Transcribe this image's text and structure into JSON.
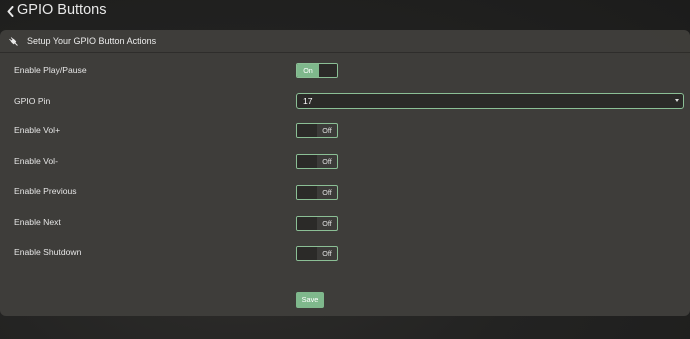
{
  "header": {
    "title": "GPIO Buttons",
    "back_icon": "chevron-left-icon"
  },
  "panel": {
    "title": "Setup Your GPIO Button Actions",
    "icon": "plug-icon"
  },
  "settings": {
    "play_pause": {
      "label": "Enable Play/Pause",
      "state": "On"
    },
    "gpio_pin": {
      "label": "GPIO Pin",
      "value": "17"
    },
    "vol_up": {
      "label": "Enable Vol+",
      "state": "Off"
    },
    "vol_down": {
      "label": "Enable Vol-",
      "state": "Off"
    },
    "previous": {
      "label": "Enable Previous",
      "state": "Off"
    },
    "next": {
      "label": "Enable Next",
      "state": "Off"
    },
    "shutdown": {
      "label": "Enable Shutdown",
      "state": "Off"
    }
  },
  "actions": {
    "save_label": "Save"
  },
  "colors": {
    "accent": "#7fb88c",
    "panel_bg": "#3f3e3b",
    "field_bg": "#2b2a28",
    "text": "#e6e6e6"
  }
}
